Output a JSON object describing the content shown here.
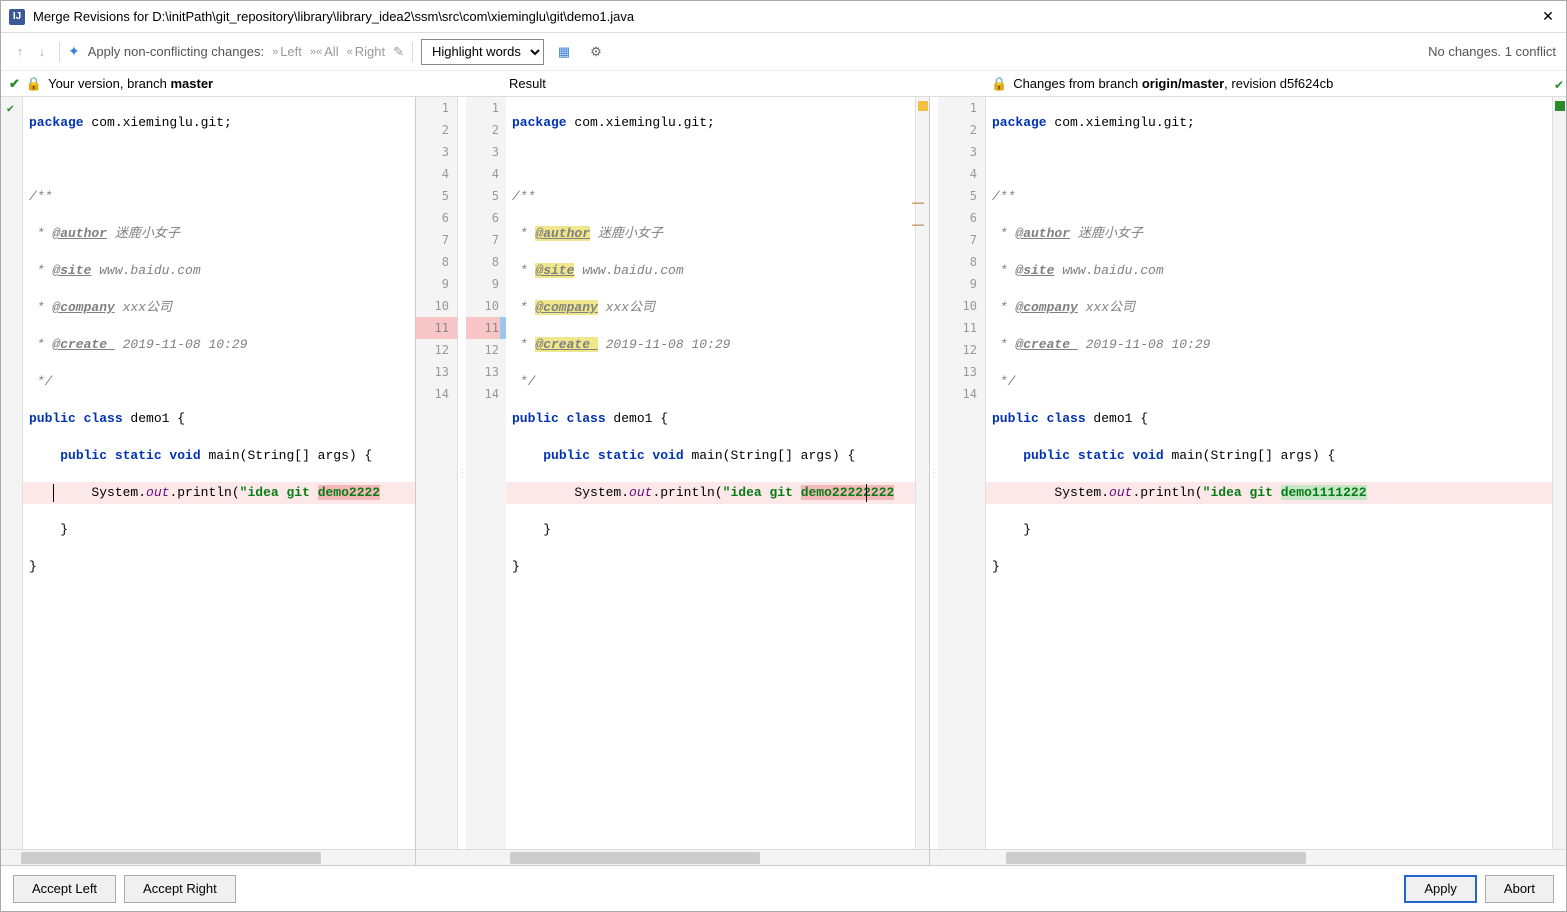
{
  "window": {
    "title": "Merge Revisions for D:\\initPath\\git_repository\\library\\library_idea2\\ssm\\src\\com\\xieminglu\\git\\demo1.java"
  },
  "toolbar": {
    "apply_label": "Apply non-conflicting changes:",
    "left": "Left",
    "all": "All",
    "right": "Right",
    "highlight_mode": "Highlight words",
    "status": "No changes. 1 conflict"
  },
  "headers": {
    "left_prefix": "Your version, branch ",
    "left_branch": "master",
    "middle": "Result",
    "right_prefix": "Changes from branch ",
    "right_branch": "origin/master",
    "right_suffix": ", revision d5f624cb"
  },
  "code": {
    "pkg_kw": "package",
    "pkg_name": " com.xieminglu.git;",
    "doc_open": "/**",
    "doc_author_tag": "@author",
    "doc_author_val": " 迷鹿小女子",
    "doc_site_tag": "@site",
    "doc_site_val": " www.baidu.com",
    "doc_company_tag": "@company",
    "doc_company_val": " xxx公司",
    "doc_create_tag": "@create ",
    "doc_create_val": " 2019-11-08 10:29",
    "doc_close": " */",
    "class_kw": "public class",
    "class_name": " demo1 {",
    "main_kw1": "public static void",
    "main_sig": " main(String[] args) {",
    "print_prefix": "System.",
    "print_out": "out",
    "print_call": ".println(",
    "str_q": "\"",
    "str_common": "idea git ",
    "str_left": "demo2222",
    "str_mid": "demo22222222",
    "str_right": "demo1111222",
    "brace_close1": "}",
    "brace_close2": "}",
    "star": " * "
  },
  "gutters": {
    "left": [
      "",
      "",
      "",
      "",
      "",
      "",
      "",
      "",
      "",
      "",
      "",
      "",
      "",
      ""
    ],
    "mid_a": [
      "1",
      "2",
      "3",
      "4",
      "5",
      "6",
      "7",
      "8",
      "9",
      "10",
      "11",
      "12",
      "13",
      "14"
    ],
    "mid_b": [
      "1",
      "2",
      "3",
      "4",
      "5",
      "6",
      "7",
      "8",
      "9",
      "10",
      "11",
      "12",
      "13",
      "14"
    ],
    "right": [
      "1",
      "2",
      "3",
      "4",
      "5",
      "6",
      "7",
      "8",
      "9",
      "10",
      "11",
      "12",
      "13",
      "14"
    ]
  },
  "buttons": {
    "accept_left": "Accept Left",
    "accept_right": "Accept Right",
    "apply": "Apply",
    "abort": "Abort"
  }
}
